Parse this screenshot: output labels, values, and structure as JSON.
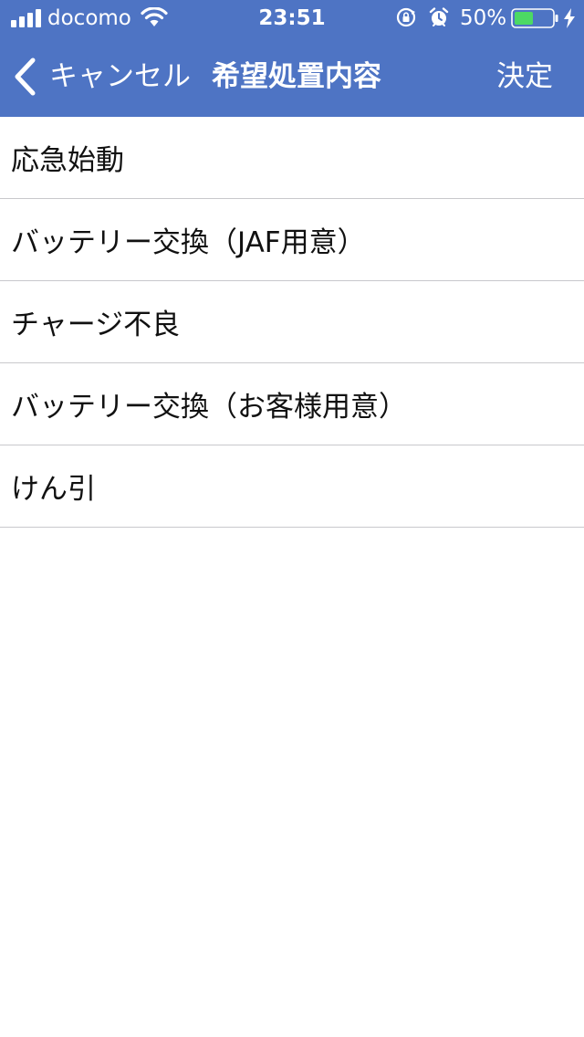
{
  "status_bar": {
    "carrier": "docomo",
    "time": "23:51",
    "battery_percent": "50%",
    "battery_level": 0.5,
    "battery_color": "#4cd964",
    "icons": [
      "signal-icon",
      "wifi-icon",
      "rotation-lock-icon",
      "alarm-icon",
      "battery-icon",
      "charging-bolt-icon"
    ]
  },
  "nav": {
    "back_label": "キャンセル",
    "title": "希望処置内容",
    "done_label": "決定",
    "background_color": "#4e74c4"
  },
  "options": [
    {
      "label": "応急始動"
    },
    {
      "label": "バッテリー交換（JAF用意）"
    },
    {
      "label": "チャージ不良"
    },
    {
      "label": "バッテリー交換（お客様用意）"
    },
    {
      "label": "けん引"
    }
  ]
}
